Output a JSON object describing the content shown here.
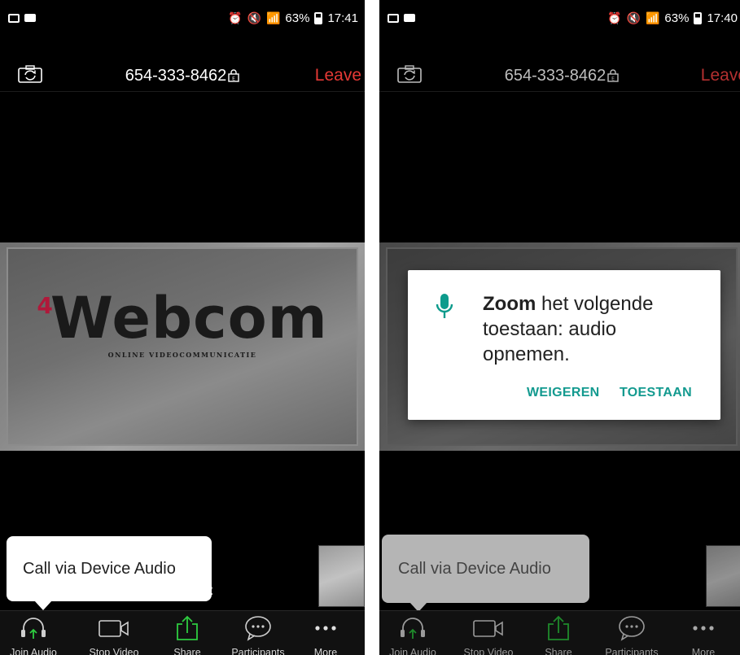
{
  "colors": {
    "leave_red": "#e53935",
    "dialog_button_teal": "#139a8f",
    "share_green": "#2ecc40",
    "mic_green": "#0d9b8c"
  },
  "screens": [
    {
      "status": {
        "battery": "63%",
        "time": "17:41"
      },
      "meeting_id": "654-333-8462",
      "leave_label": "Leave",
      "video_logo": {
        "superscript": "4",
        "name": "Webcom",
        "tagline": "ONLINE VIDEOCOMMUNICATIE"
      },
      "tooltip": "Call via Device Audio",
      "participant_count_fragment": "2",
      "toolbar": [
        {
          "label": "Join Audio",
          "icon": "headphones-icon"
        },
        {
          "label": "Stop Video",
          "icon": "video-camera-icon"
        },
        {
          "label": "Share",
          "icon": "share-icon"
        },
        {
          "label": "Participants",
          "icon": "participants-chat-icon"
        },
        {
          "label": "More",
          "icon": "more-icon"
        }
      ]
    },
    {
      "status": {
        "battery": "63%",
        "time": "17:40"
      },
      "meeting_id": "654-333-8462",
      "leave_label": "Leave",
      "dialog": {
        "app_name": "Zoom",
        "message": " het volgende toestaan: audio opnemen.",
        "deny": "WEIGEREN",
        "allow": "TOESTAAN",
        "icon": "microphone-icon"
      },
      "tooltip": "Call via Device Audio",
      "toolbar": [
        {
          "label": "Join Audio",
          "icon": "headphones-icon"
        },
        {
          "label": "Stop Video",
          "icon": "video-camera-icon"
        },
        {
          "label": "Share",
          "icon": "share-icon"
        },
        {
          "label": "Participants",
          "icon": "participants-chat-icon"
        },
        {
          "label": "More",
          "icon": "more-icon"
        }
      ]
    }
  ]
}
